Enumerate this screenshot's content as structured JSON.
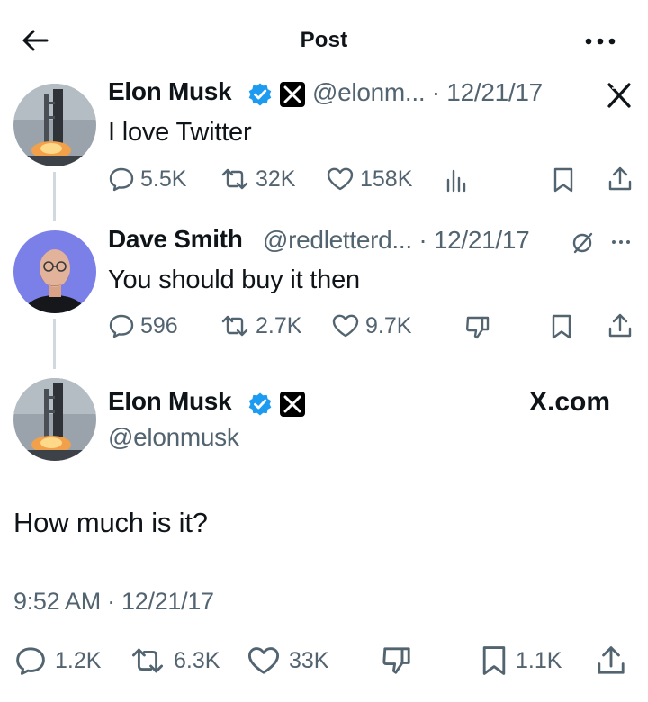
{
  "header": {
    "title": "Post"
  },
  "tweets": [
    {
      "name": "Elon Musk",
      "handle_meta": "@elonm... · 12/21/17",
      "text": "I love Twitter",
      "actions": {
        "replies": "5.5K",
        "reposts": "32K",
        "likes": "158K"
      }
    },
    {
      "name": "Dave Smith",
      "handle_meta": "@redletterd... · 12/21/17",
      "text": "You should buy it then",
      "actions": {
        "replies": "596",
        "reposts": "2.7K",
        "likes": "9.7K"
      }
    }
  ],
  "main_tweet": {
    "name": "Elon Musk",
    "handle": "@elonmusk",
    "brand": "X.com",
    "text": "How much is it?",
    "timestamp": "9:52 AM · 12/21/17",
    "actions": {
      "replies": "1.2K",
      "reposts": "6.3K",
      "likes": "33K",
      "bookmarks": "1.1K"
    }
  },
  "colors": {
    "verified": "#1d9bf0",
    "secondary_text": "#536471",
    "thread_line": "#cfd9de",
    "avatar_dave_bg": "#7b7fe8"
  },
  "icons": [
    "back-arrow-icon",
    "more-icon",
    "verified-icon",
    "x-logo-icon",
    "reply-icon",
    "repost-icon",
    "like-icon",
    "views-icon",
    "bookmark-icon",
    "share-icon",
    "grok-icon",
    "dislike-icon"
  ]
}
